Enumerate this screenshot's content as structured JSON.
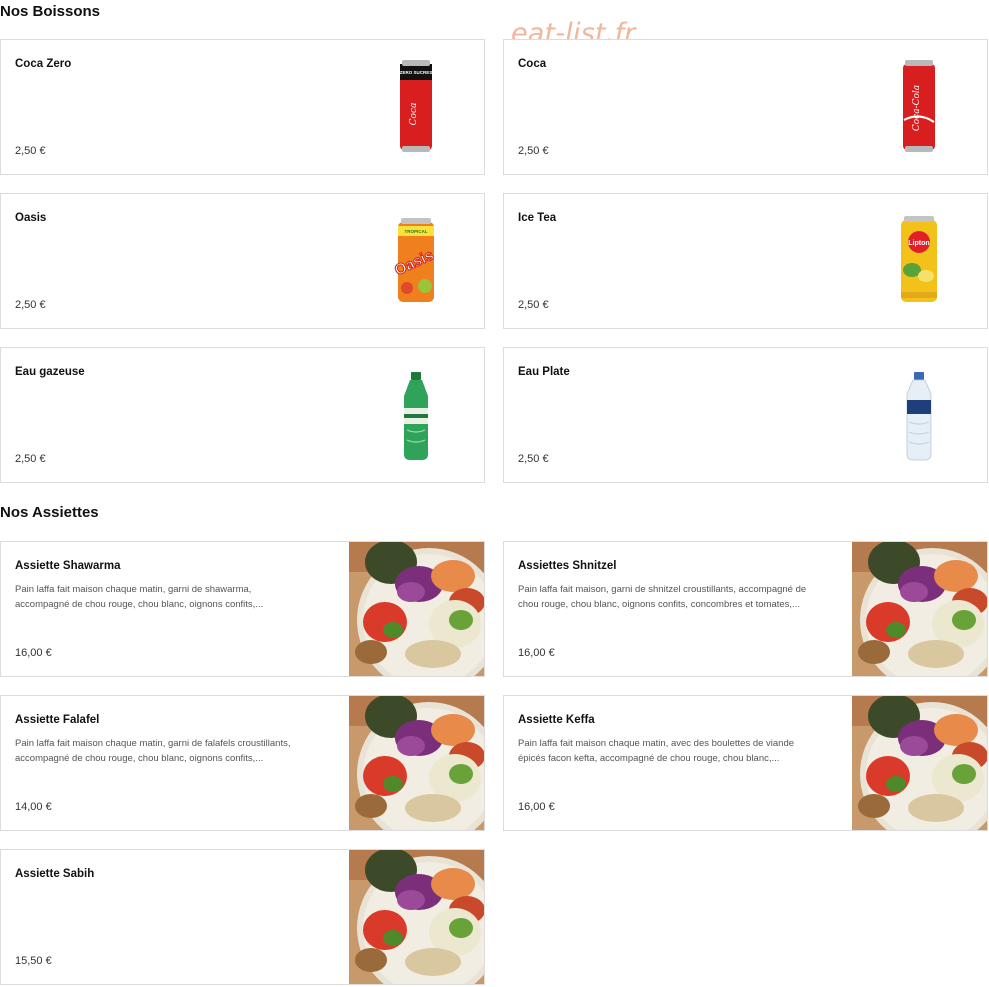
{
  "watermark": "eat-list.fr",
  "sections": {
    "drinks_title": "Nos Boissons",
    "plates_title": "Nos Assiettes"
  },
  "drinks": [
    {
      "name": "Coca Zero",
      "price": "2,50 €",
      "icon": "coca-zero-can",
      "can_text": "ZERO SUCRES"
    },
    {
      "name": "Coca",
      "price": "2,50 €",
      "icon": "coca-cola-can"
    },
    {
      "name": "Oasis",
      "price": "2,50 €",
      "icon": "oasis-can",
      "can_text": "TROPICAL"
    },
    {
      "name": "Ice Tea",
      "price": "2,50 €",
      "icon": "lipton-ice-tea-can",
      "can_text": "Lipton"
    },
    {
      "name": "Eau gazeuse",
      "price": "2,50 €",
      "icon": "sparkling-water-bottle"
    },
    {
      "name": "Eau Plate",
      "price": "2,50 €",
      "icon": "still-water-bottle"
    }
  ],
  "plates": [
    {
      "name": "Assiette Shawarma",
      "desc_1": "Pain laffa fait maison chaque matin, garni de shawarma,",
      "desc_2": "accompagné de chou rouge, chou blanc, oignons confits,...",
      "price": "16,00 €",
      "icon": "plate-photo"
    },
    {
      "name": "Assiettes Shnitzel",
      "desc_1": "Pain laffa fait maison, garni de shnitzel croustillants, accompagné de",
      "desc_2": "chou rouge, chou blanc, oignons confits, concombres et tomates,...",
      "price": "16,00 €",
      "icon": "plate-photo"
    },
    {
      "name": "Assiette Falafel",
      "desc_1": "Pain laffa fait maison chaque matin, garni de falafels croustillants,",
      "desc_2": "accompagné de chou rouge, chou blanc, oignons confits,...",
      "price": "14,00 €",
      "icon": "plate-photo"
    },
    {
      "name": "Assiette Keffa",
      "desc_1": "Pain laffa fait maison chaque matin, avec des boulettes de viande",
      "desc_2": "épicés facon kefta, accompagné de chou rouge, chou blanc,...",
      "price": "16,00 €",
      "icon": "plate-photo"
    },
    {
      "name": "Assiette Sabih",
      "desc_1": "",
      "desc_2": "",
      "price": "15,50 €",
      "icon": "plate-photo"
    }
  ],
  "colors": {
    "watermark": "#f3b59a",
    "border": "#dcdcdc",
    "coca_red": "#d81e1e",
    "oasis_orange": "#f07f1d",
    "lipton_yellow": "#f2c21b",
    "sparkling_green": "#2fa35a"
  }
}
